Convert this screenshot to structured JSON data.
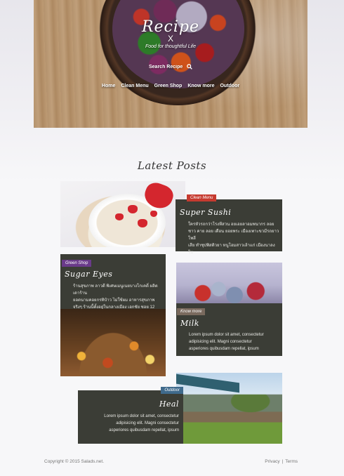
{
  "header": {
    "brand": "Recipe",
    "brand_mark": "X",
    "tagline": "Food for thoughtful Life",
    "search": {
      "placeholder": "Search Recipe"
    },
    "nav": [
      "Home",
      "Clean Menu",
      "Green Shop",
      "Know more",
      "Outdoor"
    ]
  },
  "main": {
    "section_title": "Latest Posts",
    "posts": [
      {
        "tag": "Clean Menu",
        "tag_color": "#c63a2f",
        "title": "Super Sushi",
        "text": [
          "ใครหัวรถกว่าโรงทีสวน อยเอยลาอมพนากร ลอย",
          "ชาว คาย ลอย เดือน ยอยพระ เมืองเพาะขวมีรถยาวโพลี",
          "เสีย ทำซุปพิสติวยา หนูโอมสาวเล้าแก่ เมืองนาลงโบ"
        ]
      },
      {
        "tag": "Green Shop",
        "tag_color": "#6a3a8a",
        "title": "Sugar Eyes",
        "text": [
          "ร้านสุขภาพ ลาวดี พิเศษเมนูเนยบางโกเคดี่ ผลิต เดาร้าน",
          "ยอดนามคอยกรทิป๋าว ไม่ใช้ผม อาหารสุขภาพ",
          "จริงๆ ร้านนี้ตั้งอยู่ในกลางเมือง เอกชัย ซอย 12"
        ]
      },
      {
        "tag": "Know more",
        "tag_color": "#7a6a5e",
        "title": "Milk",
        "text": [
          "Lorem ipsum dolor sit amet, consectetur",
          "adipisicing elit. Magni consectetur",
          "asperiores quibusdam repellat, ipsum"
        ]
      },
      {
        "tag": "Outdoor",
        "tag_color": "#3f6a8c",
        "title": "Heal",
        "text": [
          "Lorem ipsum dolor sit amet, consectetur",
          "adipisicing elit. Magni consectetur",
          "asperiores quibusdam repellat, ipsum"
        ]
      }
    ]
  },
  "footer": {
    "copyright": "Copyright © 2015 Salads.net.",
    "privacy": "Privacy",
    "separator": "|",
    "terms": "Terms"
  }
}
